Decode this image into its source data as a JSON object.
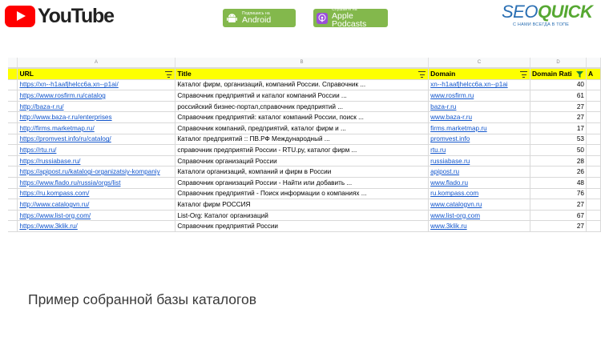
{
  "header": {
    "youtube_label": "YouTube",
    "android_small": "Подпишись на",
    "android_big": "Android",
    "podcasts_small": "Слушайте на",
    "podcasts_big": "Apple Podcasts",
    "seo_part1": "SEO",
    "seo_part2": "QUICK",
    "seo_tagline": "С НАМИ ВСЕГДА В ТОПЕ"
  },
  "sheet": {
    "column_letters": [
      "A",
      "B",
      "C",
      "D"
    ],
    "headers": [
      "URL",
      "Title",
      "Domain",
      "Domain Rati",
      "A"
    ],
    "rows": [
      {
        "url": "https://xn--h1aafjhelcc6a.xn--p1ai/",
        "title": "Каталог фирм, организаций, компаний России. Справочник ...",
        "domain": "xn--h1aafjhelcc6a.xn--p1ai",
        "rating": "40"
      },
      {
        "url": "https://www.rosfirm.ru/catalog",
        "title": "Справочник предприятий и каталог компаний России ...",
        "domain": "www.rosfirm.ru",
        "rating": "61"
      },
      {
        "url": "http://baza-r.ru/",
        "title": "российский бизнес-портал,справочник предприятий ...",
        "domain": "baza-r.ru",
        "rating": "27"
      },
      {
        "url": "http://www.baza-r.ru/enterprises",
        "title": "Справочник предприятий: каталог компаний России, поиск ...",
        "domain": "www.baza-r.ru",
        "rating": "27"
      },
      {
        "url": "http://firms.marketmap.ru/",
        "title": "Справочник компаний, предприятий, каталог фирм и ...",
        "domain": "firms.marketmap.ru",
        "rating": "17"
      },
      {
        "url": "https://promvest.info/ru/catalog/",
        "title": "Каталог предприятий :: ПВ.РФ Международный ...",
        "domain": "promvest.info",
        "rating": "53"
      },
      {
        "url": "https://rtu.ru/",
        "title": "справочник предприятий России - RTU.ру, каталог фирм ...",
        "domain": "rtu.ru",
        "rating": "50"
      },
      {
        "url": "https://russiabase.ru/",
        "title": "Справочник организаций России",
        "domain": "russiabase.ru",
        "rating": "28"
      },
      {
        "url": "https://apipost.ru/katalogi-organizatsiy-kompaniy",
        "title": "Каталоги организаций, компаний и фирм в России",
        "domain": "apipost.ru",
        "rating": "26"
      },
      {
        "url": "https://www.flado.ru/russia/orgs/list",
        "title": "Справочник организаций России - Найти или добавить ...",
        "domain": "www.flado.ru",
        "rating": "48"
      },
      {
        "url": "https://ru.kompass.com/",
        "title": "Справочник предприятий - Поиск информации о компаниях ...",
        "domain": "ru.kompass.com",
        "rating": "76"
      },
      {
        "url": "http://www.catalogvn.ru/",
        "title": "Каталог фирм РОССИЯ",
        "domain": "www.catalogvn.ru",
        "rating": "27"
      },
      {
        "url": "https://www.list-org.com/",
        "title": "List-Org: Каталог организаций",
        "domain": "www.list-org.com",
        "rating": "67"
      },
      {
        "url": "https://www.3klik.ru/",
        "title": "Справочник предприятий России",
        "domain": "www.3klik.ru",
        "rating": "27"
      }
    ]
  },
  "caption": "Пример собранной базы каталогов",
  "colors": {
    "header_yellow": "#fdff00",
    "link_blue": "#1155cc",
    "badge_green": "#83b84c",
    "youtube_red": "#ff0000"
  }
}
